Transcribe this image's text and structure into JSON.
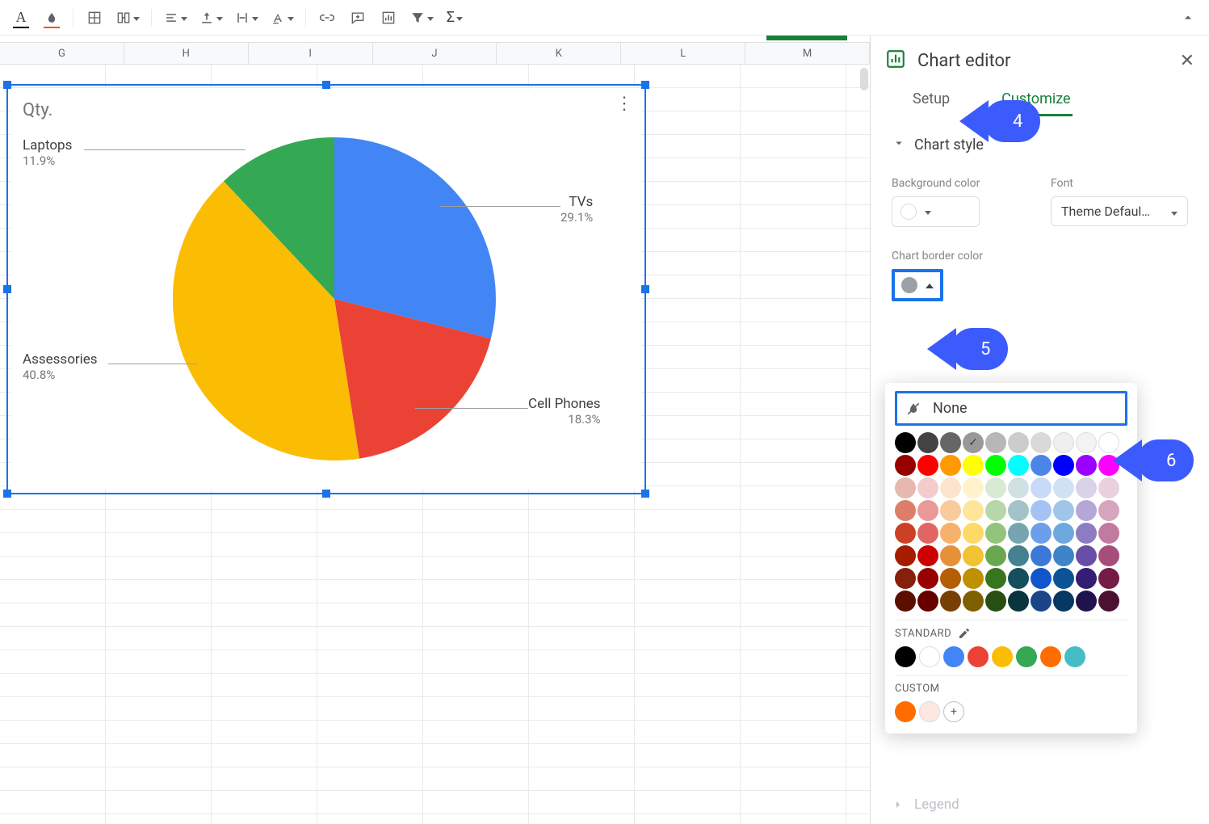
{
  "toolbar": {
    "text_color_char": "A",
    "fill_color_char": "A"
  },
  "columns": [
    "G",
    "H",
    "I",
    "J",
    "K",
    "L",
    "M"
  ],
  "chart": {
    "title": "Qty.",
    "labels": {
      "tvs": {
        "name": "TVs",
        "pct": "29.1%"
      },
      "cell": {
        "name": "Cell Phones",
        "pct": "18.3%"
      },
      "acc": {
        "name": "Assessories",
        "pct": "40.8%"
      },
      "lap": {
        "name": "Laptops",
        "pct": "11.9%"
      }
    }
  },
  "chart_data": {
    "type": "pie",
    "title": "Qty.",
    "categories": [
      "TVs",
      "Cell Phones",
      "Assessories",
      "Laptops"
    ],
    "values": [
      29.1,
      18.3,
      40.8,
      11.9
    ],
    "colors": [
      "#4285F4",
      "#EA4335",
      "#FBBC04",
      "#34A853"
    ]
  },
  "panel": {
    "title": "Chart editor",
    "tabs": {
      "setup": "Setup",
      "customize": "Customize"
    },
    "section": "Chart style",
    "bg_label": "Background color",
    "font_label": "Font",
    "font_value": "Theme Defaul…",
    "border_label": "Chart border color",
    "picker": {
      "none": "None",
      "standard": "STANDARD",
      "custom": "CUSTOM"
    },
    "legend": "Legend"
  },
  "callouts": {
    "c4": "4",
    "c5": "5",
    "c6": "6"
  },
  "palette_main": [
    [
      "#000000",
      "#434343",
      "#666666",
      "#999999",
      "#b7b7b7",
      "#cccccc",
      "#d9d9d9",
      "#efefef",
      "#f3f3f3",
      "#ffffff"
    ],
    [
      "#980000",
      "#ff0000",
      "#ff9900",
      "#ffff00",
      "#00ff00",
      "#00ffff",
      "#4a86e8",
      "#0000ff",
      "#9900ff",
      "#ff00ff"
    ],
    [
      "#e6b8af",
      "#f4cccc",
      "#fce5cd",
      "#fff2cc",
      "#d9ead3",
      "#d0e0e3",
      "#c9daf8",
      "#cfe2f3",
      "#d9d2e9",
      "#ead1dc"
    ],
    [
      "#dd7e6b",
      "#ea9999",
      "#f9cb9c",
      "#ffe599",
      "#b6d7a8",
      "#a2c4c9",
      "#a4c2f4",
      "#9fc5e8",
      "#b4a7d6",
      "#d5a6bd"
    ],
    [
      "#cc4125",
      "#e06666",
      "#f6b26b",
      "#ffd966",
      "#93c47d",
      "#76a5af",
      "#6d9eeb",
      "#6fa8dc",
      "#8e7cc3",
      "#c27ba0"
    ],
    [
      "#a61c00",
      "#cc0000",
      "#e69138",
      "#f1c232",
      "#6aa84f",
      "#45818e",
      "#3c78d8",
      "#3d85c6",
      "#674ea7",
      "#a64d79"
    ],
    [
      "#85200c",
      "#990000",
      "#b45f06",
      "#bf9000",
      "#38761d",
      "#134f5c",
      "#1155cc",
      "#0b5394",
      "#351c75",
      "#741b47"
    ],
    [
      "#5b0f00",
      "#660000",
      "#783f04",
      "#7f6000",
      "#274e13",
      "#0c343d",
      "#1c4587",
      "#073763",
      "#20124d",
      "#4c1130"
    ]
  ],
  "palette_standard": [
    "#000000",
    "#ffffff",
    "#4285F4",
    "#EA4335",
    "#FBBC04",
    "#34A853",
    "#FF6D01",
    "#46BDC6"
  ],
  "palette_custom": [
    "#FF6D01",
    "#fce8e0"
  ]
}
